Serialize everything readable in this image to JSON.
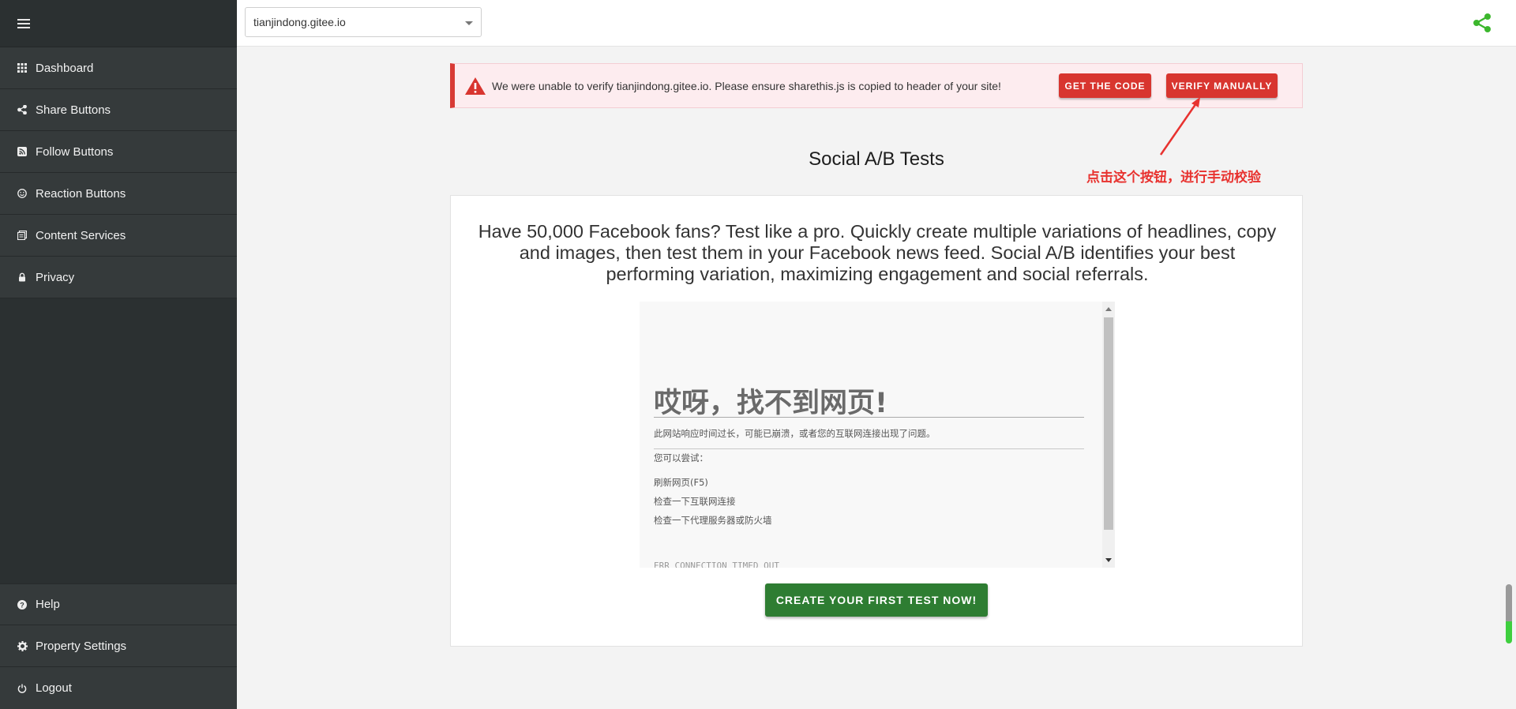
{
  "topbar": {
    "site_select_value": "tianjindong.gitee.io"
  },
  "sidebar": {
    "items": [
      {
        "label": "Dashboard",
        "icon": "grid-icon"
      },
      {
        "label": "Share Buttons",
        "icon": "share-icon"
      },
      {
        "label": "Follow Buttons",
        "icon": "rss-icon"
      },
      {
        "label": "Reaction Buttons",
        "icon": "smiley-icon"
      },
      {
        "label": "Content Services",
        "icon": "documents-icon"
      },
      {
        "label": "Privacy",
        "icon": "lock-icon"
      }
    ],
    "bottom_items": [
      {
        "label": "Help",
        "icon": "question-icon"
      },
      {
        "label": "Property Settings",
        "icon": "gear-icon"
      },
      {
        "label": "Logout",
        "icon": "power-icon"
      }
    ]
  },
  "alert": {
    "message": "We were unable to verify tianjindong.gitee.io. Please ensure sharethis.js is copied to header of your site!",
    "get_code_label": "GET THE CODE",
    "verify_label": "VERIFY MANUALLY"
  },
  "annotation": {
    "text": "点击这个按钮，进行手动校验",
    "color": "#e8322f"
  },
  "main": {
    "heading": "Social A/B Tests",
    "description": "Have 50,000 Facebook fans? Test like a pro. Quickly create multiple variations of headlines, copy and images, then test them in your Facebook news feed. Social A/B identifies your best performing variation, maximizing engagement and social referrals.",
    "cta_label": "CREATE YOUR FIRST TEST NOW!"
  },
  "embedded_error": {
    "title": "哎呀，找不到网页!",
    "message": "此网站响应时间过长，可能已崩溃，或者您的互联网连接出现了问题。",
    "try_label": "您可以尝试：",
    "suggestions": [
      "刷新网页(F5)",
      "检查一下互联网连接",
      "检查一下代理服务器或防火墙"
    ],
    "error_code": "ERR_CONNECTION_TIMED_OUT"
  },
  "colors": {
    "sidebar_bg": "#2b3031",
    "alert_red": "#d8352f",
    "cta_green": "#2e7d32",
    "share_green": "#3cb72d"
  }
}
